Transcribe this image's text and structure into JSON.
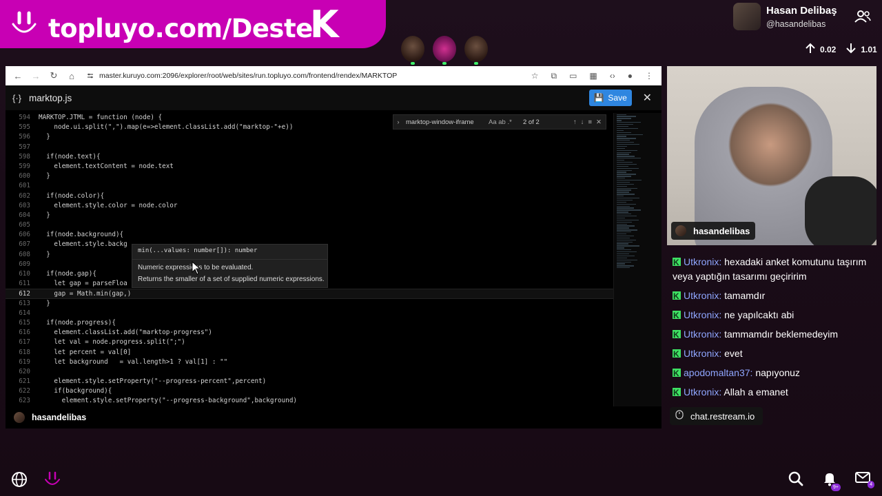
{
  "banner": {
    "text": "topluyo.com/Deste",
    "k_letter": "K"
  },
  "profile": {
    "name": "Hasan Delibaş",
    "handle": "@hasandelibas"
  },
  "network": {
    "up": "0.02",
    "down": "1.01"
  },
  "browser": {
    "url": "master.kuruyo.com:2096/explorer/root/web/sites/run.topluyo.com/frontend/rendex/MARKTOP"
  },
  "editor": {
    "file_name": "marktop.js",
    "save_label": "Save",
    "find": {
      "query": "marktop-window-iframe",
      "options": "Aa  ab  .*",
      "count": "2 of 2"
    },
    "tooltip": {
      "signature": "min(...values: number[]): number",
      "param_desc": "Numeric expressions to be evaluated.",
      "description": "Returns the smaller of a set of supplied numeric expressions."
    },
    "lines": [
      {
        "n": "594",
        "t": "MARKTOP.JTML = function (node) {"
      },
      {
        "n": "595",
        "t": "    node.ui.split(\",\").map(e=>element.classList.add(\"marktop-\"+e))"
      },
      {
        "n": "596",
        "t": "  }"
      },
      {
        "n": "597",
        "t": ""
      },
      {
        "n": "598",
        "t": "  if(node.text){"
      },
      {
        "n": "599",
        "t": "    element.textContent = node.text"
      },
      {
        "n": "600",
        "t": "  }"
      },
      {
        "n": "601",
        "t": ""
      },
      {
        "n": "602",
        "t": "  if(node.color){"
      },
      {
        "n": "603",
        "t": "    element.style.color = node.color"
      },
      {
        "n": "604",
        "t": "  }"
      },
      {
        "n": "605",
        "t": ""
      },
      {
        "n": "606",
        "t": "  if(node.background){"
      },
      {
        "n": "607",
        "t": "    element.style.backg"
      },
      {
        "n": "608",
        "t": "  }"
      },
      {
        "n": "609",
        "t": ""
      },
      {
        "n": "610",
        "t": "  if(node.gap){"
      },
      {
        "n": "611",
        "t": "    let gap = parseFloa"
      },
      {
        "n": "612",
        "t": "    gap = Math.min(gap,)"
      },
      {
        "n": "613",
        "t": "  }"
      },
      {
        "n": "614",
        "t": ""
      },
      {
        "n": "615",
        "t": "  if(node.progress){"
      },
      {
        "n": "616",
        "t": "    element.classList.add(\"marktop-progress\")"
      },
      {
        "n": "617",
        "t": "    let val = node.progress.split(\";\")"
      },
      {
        "n": "618",
        "t": "    let percent = val[0]"
      },
      {
        "n": "619",
        "t": "    let background   = val.length>1 ? val[1] : \"\""
      },
      {
        "n": "620",
        "t": ""
      },
      {
        "n": "621",
        "t": "    element.style.setProperty(\"--progress-percent\",percent)"
      },
      {
        "n": "622",
        "t": "    if(background){"
      },
      {
        "n": "623",
        "t": "      element.style.setProperty(\"--progress-background\",background)"
      }
    ],
    "footer_user": "hasandelibas"
  },
  "webcam": {
    "tag": "hasandelibas"
  },
  "chat": {
    "messages": [
      {
        "user": "Utkronix:",
        "text": "hexadaki anket komutunu taşırım veya yaptığın tasarımı geçiririm"
      },
      {
        "user": "Utkronix:",
        "text": "tamamdır"
      },
      {
        "user": "Utkronix:",
        "text": "ne yapılcaktı abi"
      },
      {
        "user": "Utkronix:",
        "text": "tammamdır beklemedeyim"
      },
      {
        "user": "Utkronix:",
        "text": "evet"
      },
      {
        "user": "apodomaltan37:",
        "text": "napıyonuz"
      },
      {
        "user": "Utkronix:",
        "text": "Allah a emanet"
      }
    ],
    "footer": "chat.restream.io"
  },
  "bottom": {
    "notif_badge": "9+",
    "mail_badge": "4"
  },
  "colors": {
    "accent": "#c800b4",
    "save": "#2f86e0",
    "chat_user": "#8fa6ff",
    "kick_green": "#3ee063"
  }
}
